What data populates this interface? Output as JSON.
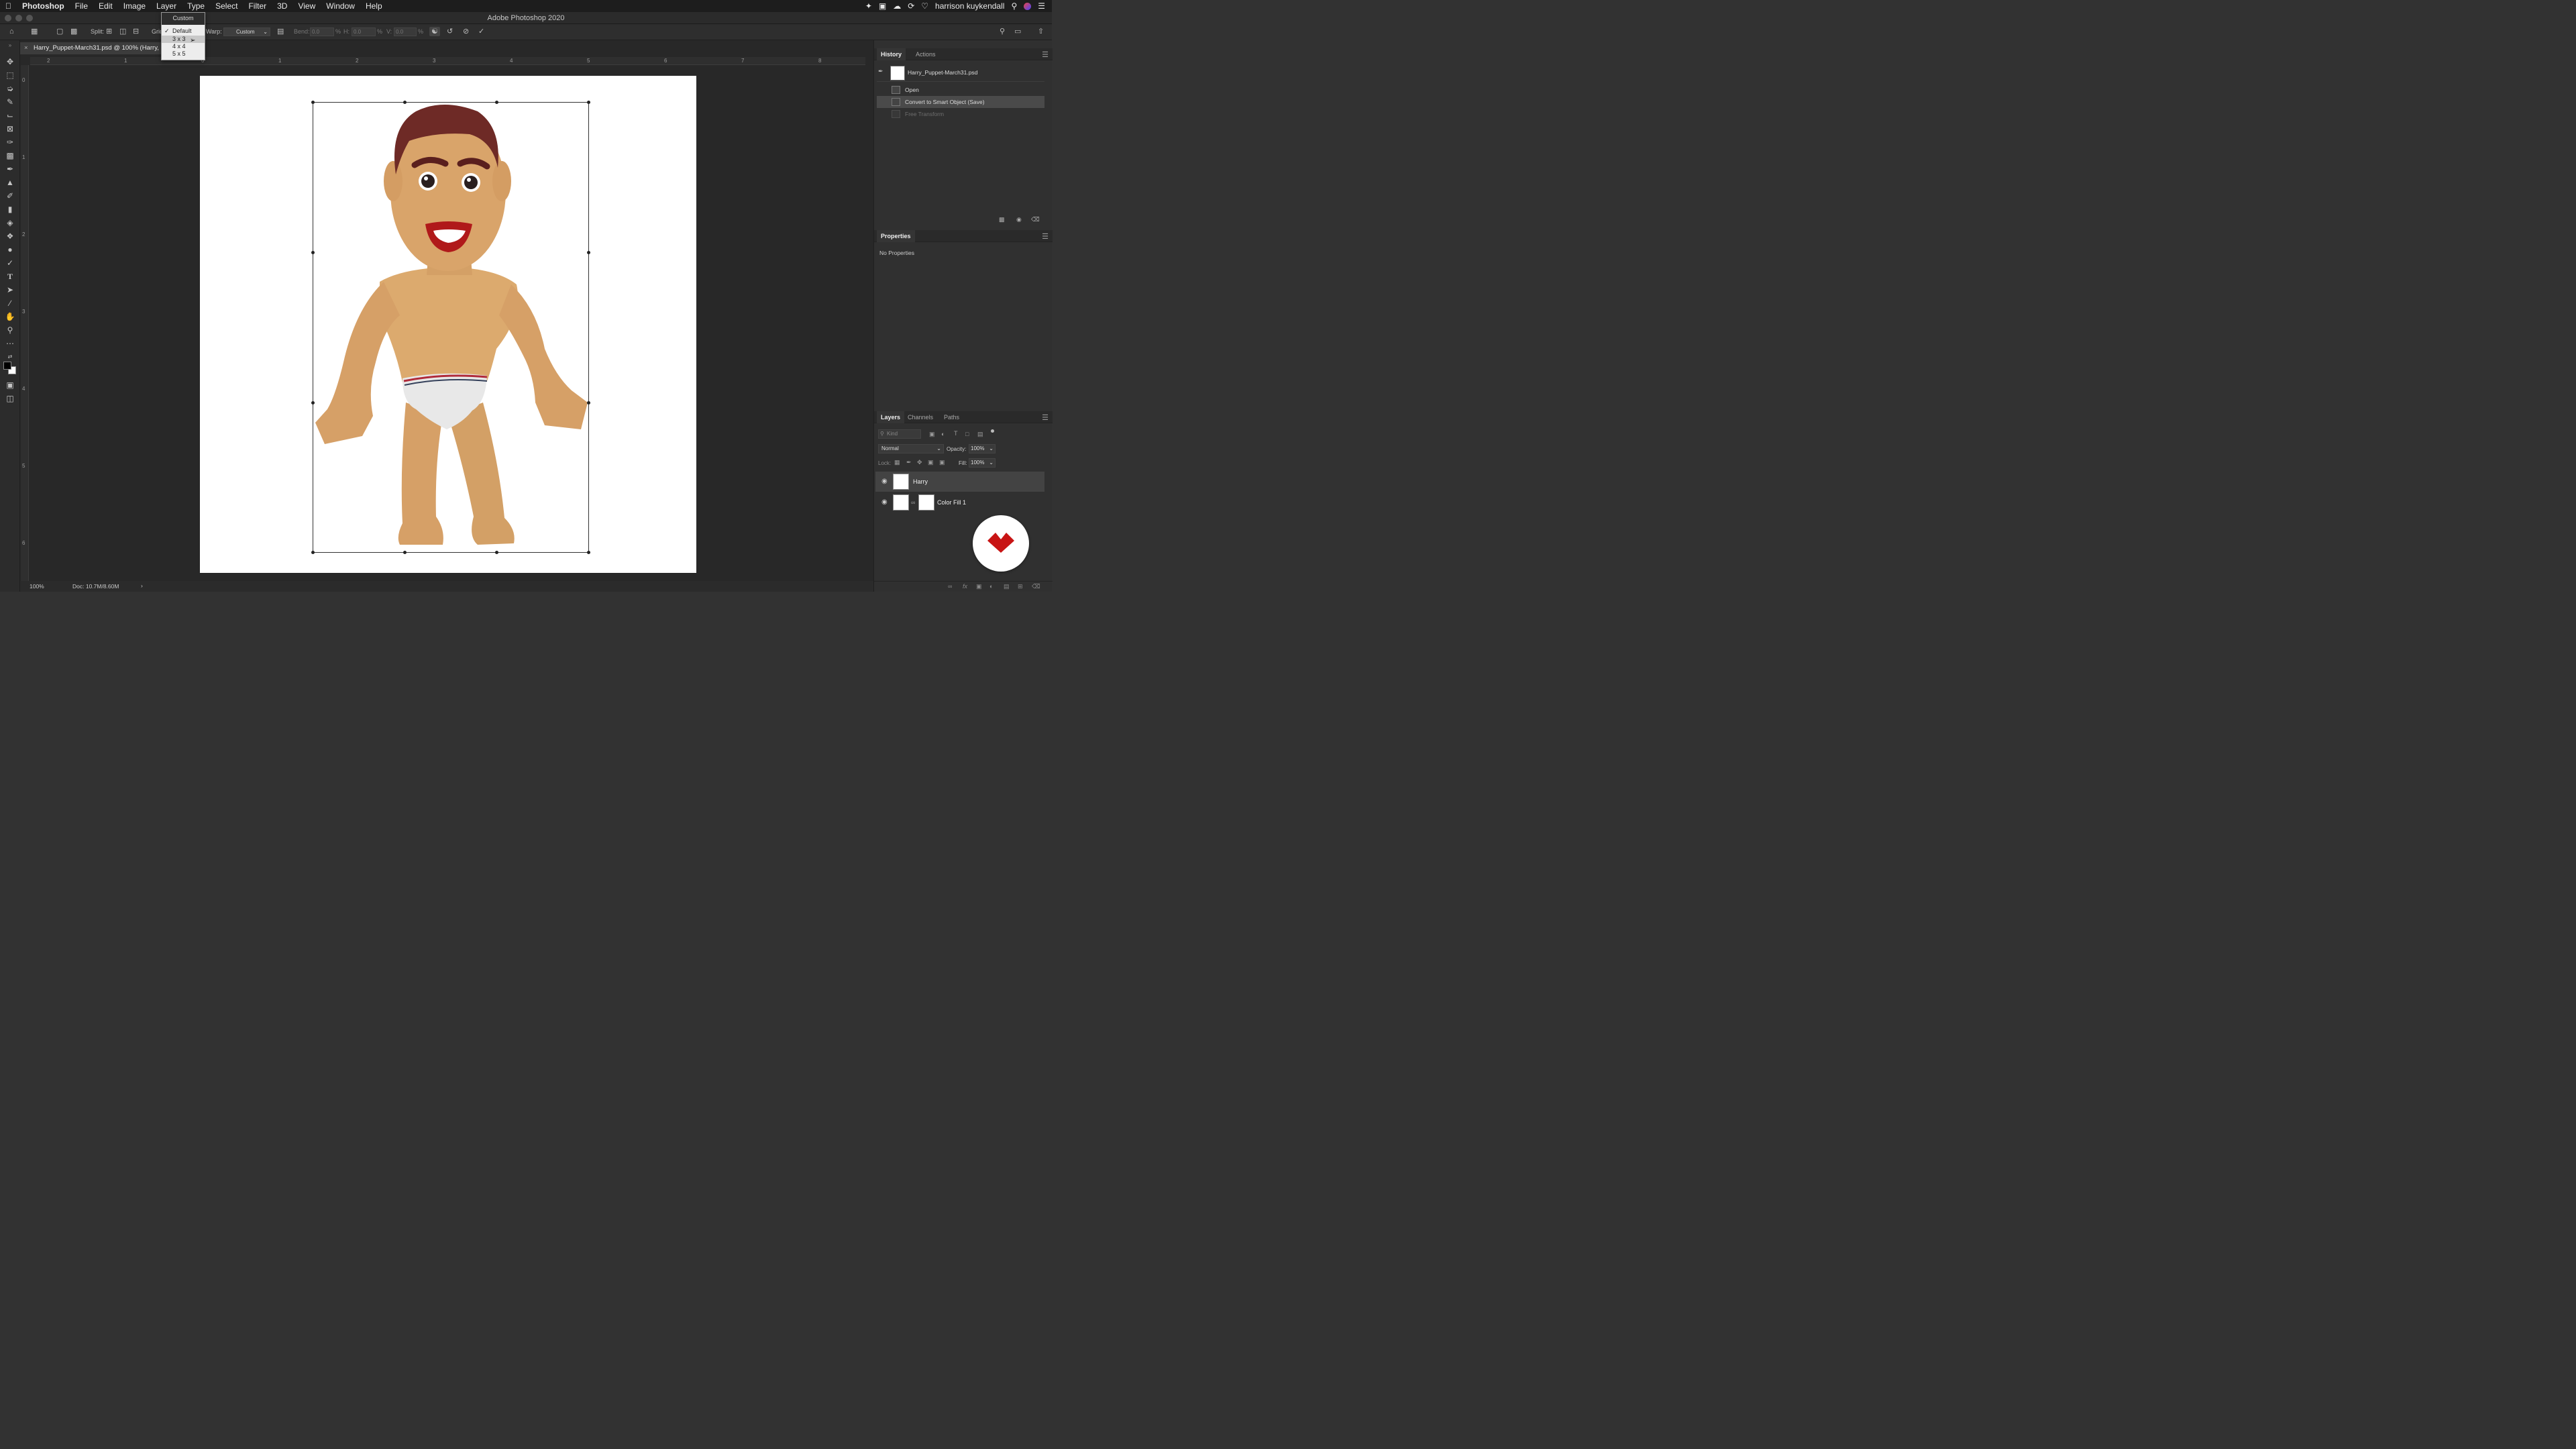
{
  "menubar": {
    "apple": "",
    "items": [
      "Photoshop",
      "File",
      "Edit",
      "Image",
      "Layer",
      "Type",
      "Select",
      "Filter",
      "3D",
      "View",
      "Window",
      "Help"
    ],
    "user": "harrison kuykendall"
  },
  "window": {
    "title": "Adobe Photoshop 2020"
  },
  "options": {
    "split_label": "Split:",
    "grid_label": "Grid",
    "warp_label": "Warp:",
    "warp_value": "Custom",
    "bend_label": "Bend:",
    "bend_value": "0.0",
    "h_label": "H:",
    "h_value": "0.0",
    "v_label": "V:",
    "v_value": "0.0",
    "pct": "%"
  },
  "grid_dropdown": {
    "header": "Custom",
    "items": [
      "Default",
      "3 x 3",
      "4 x 4",
      "5 x 5"
    ],
    "checked": "Default",
    "hovered": "3 x 3"
  },
  "document": {
    "tab_title": "Harry_Puppet-March31.psd @ 100% (Harry,"
  },
  "rulers": {
    "h": [
      "2",
      "1",
      "0",
      "1",
      "2",
      "3",
      "4",
      "5",
      "6",
      "7",
      "8"
    ],
    "v": [
      "0",
      "1",
      "2",
      "3",
      "4",
      "5",
      "6"
    ]
  },
  "status": {
    "zoom": "100%",
    "doc": "Doc: 10.7M/8.60M"
  },
  "history": {
    "tabs": [
      "History",
      "Actions"
    ],
    "snapshot": "Harry_Puppet-March31.psd",
    "steps": [
      "Open",
      "Convert to Smart Object (Save)",
      "Free Transform"
    ]
  },
  "properties": {
    "title": "Properties",
    "empty": "No Properties"
  },
  "layers": {
    "tabs": [
      "Layers",
      "Channels",
      "Paths"
    ],
    "kind_placeholder": "Kind",
    "blend_mode": "Normal",
    "opacity_label": "Opacity:",
    "opacity": "100%",
    "lock_label": "Lock:",
    "fill_label": "Fill:",
    "fill": "100%",
    "items": [
      {
        "name": "Harry",
        "selected": true
      },
      {
        "name": "Color Fill 1",
        "selected": false
      }
    ]
  },
  "colors": {
    "accent": "#c81414",
    "canvas": "#ffffff",
    "skin": "#d9a46a",
    "hair": "#6e2a26"
  }
}
